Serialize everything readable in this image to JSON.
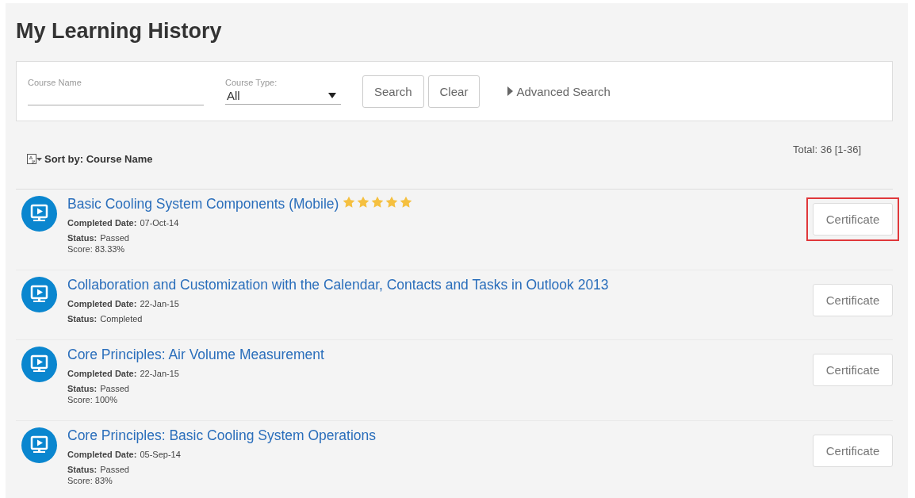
{
  "title": "My Learning History",
  "search": {
    "course_name": {
      "label": "Course Name"
    },
    "course_type": {
      "label": "Course Type:",
      "value": "All"
    },
    "buttons": [
      "Search",
      "Clear"
    ],
    "advanced_search": "Advanced Search"
  },
  "sort": {
    "label": "Sort by: Course Name"
  },
  "total": "Total: 36 [1-36]",
  "courses": [
    {
      "title": "Basic Cooling System Components (Mobile)",
      "stars": 5,
      "completed_label": "Completed Date:",
      "completed_date": "07-Oct-14",
      "status_label": "Status:",
      "status": "Passed",
      "score": "Score: 83.33%",
      "button": "Certificate",
      "highlighted": true
    },
    {
      "title": "Collaboration and Customization with the Calendar, Contacts and Tasks in Outlook 2013",
      "completed_label": "Completed Date:",
      "completed_date": "22-Jan-15",
      "status_label": "Status:",
      "status": "Completed",
      "button": "Certificate",
      "highlighted": false
    },
    {
      "title": "Core Principles: Air Volume Measurement",
      "completed_label": "Completed Date:",
      "completed_date": "22-Jan-15",
      "status_label": "Status:",
      "status": "Passed",
      "score": "Score: 100%",
      "button": "Certificate",
      "highlighted": false
    },
    {
      "title": "Core Principles: Basic Cooling System Operations",
      "completed_label": "Completed Date:",
      "completed_date": "05-Sep-14",
      "status_label": "Status:",
      "status": "Passed",
      "score": "Score: 83%",
      "button": "Certificate",
      "highlighted": false
    }
  ]
}
